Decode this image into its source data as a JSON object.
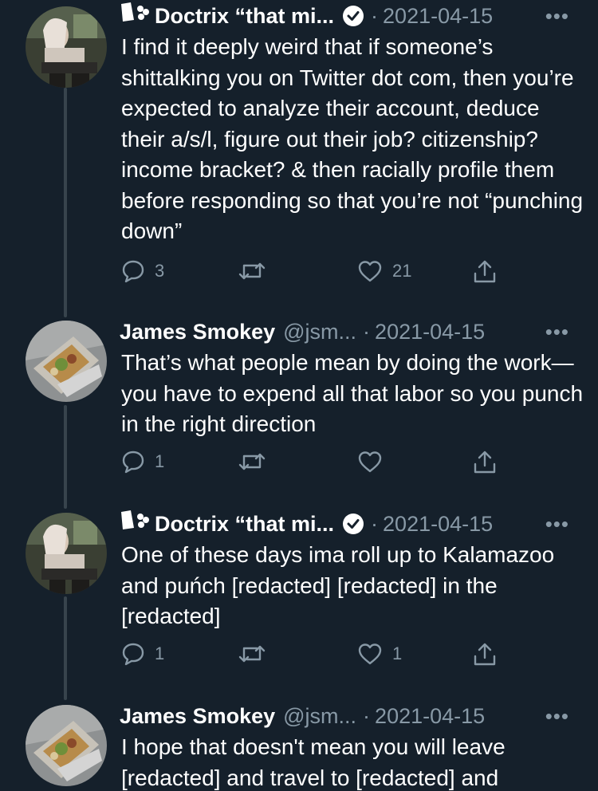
{
  "colors": {
    "background": "#15202b",
    "text_primary": "#ffffff",
    "text_secondary": "#8899a6",
    "thread_line": "#38444d",
    "verified_badge": "#ffffff"
  },
  "tweets": [
    {
      "name_prefix_icon": "clown-emoji-icon",
      "name": "Doctrix “that mi...",
      "handle": "",
      "verified": true,
      "date_separator": "·",
      "date": "2021-04-15",
      "more_icon": "more-options-icon",
      "text": "I find it deeply weird that if someone’s shittalking you on Twitter dot com, then you’re expected to analyze their account, deduce their a/s/l, figure out their job? citizenship? income bracket? & then racially profile them before responding so that you’re not “punching down”",
      "reply_count": "3",
      "retweet_count": "",
      "like_count": "21"
    },
    {
      "name_prefix_icon": "",
      "name": "James Smokey",
      "handle": "@jsm...",
      "verified": false,
      "date_separator": "·",
      "date": "2021-04-15",
      "more_icon": "more-options-icon",
      "text": "That’s what people mean by doing the work—you have to expend all that labor so you punch in the right direction",
      "reply_count": "1",
      "retweet_count": "",
      "like_count": ""
    },
    {
      "name_prefix_icon": "clown-emoji-icon",
      "name": "Doctrix “that mi...",
      "handle": "",
      "verified": true,
      "date_separator": "·",
      "date": "2021-04-15",
      "more_icon": "more-options-icon",
      "text": "One of these days ima roll up to Kalamazoo and puńch [redacted] [redacted] in the [redacted]",
      "reply_count": "1",
      "retweet_count": "",
      "like_count": "1"
    },
    {
      "name_prefix_icon": "",
      "name": "James Smokey",
      "handle": "@jsm...",
      "verified": false,
      "date_separator": "·",
      "date": "2021-04-15",
      "more_icon": "more-options-icon",
      "text": "I hope that doesn't mean you will leave [redacted] and travel to [redacted] and",
      "reply_count": "",
      "retweet_count": "",
      "like_count": ""
    }
  ]
}
